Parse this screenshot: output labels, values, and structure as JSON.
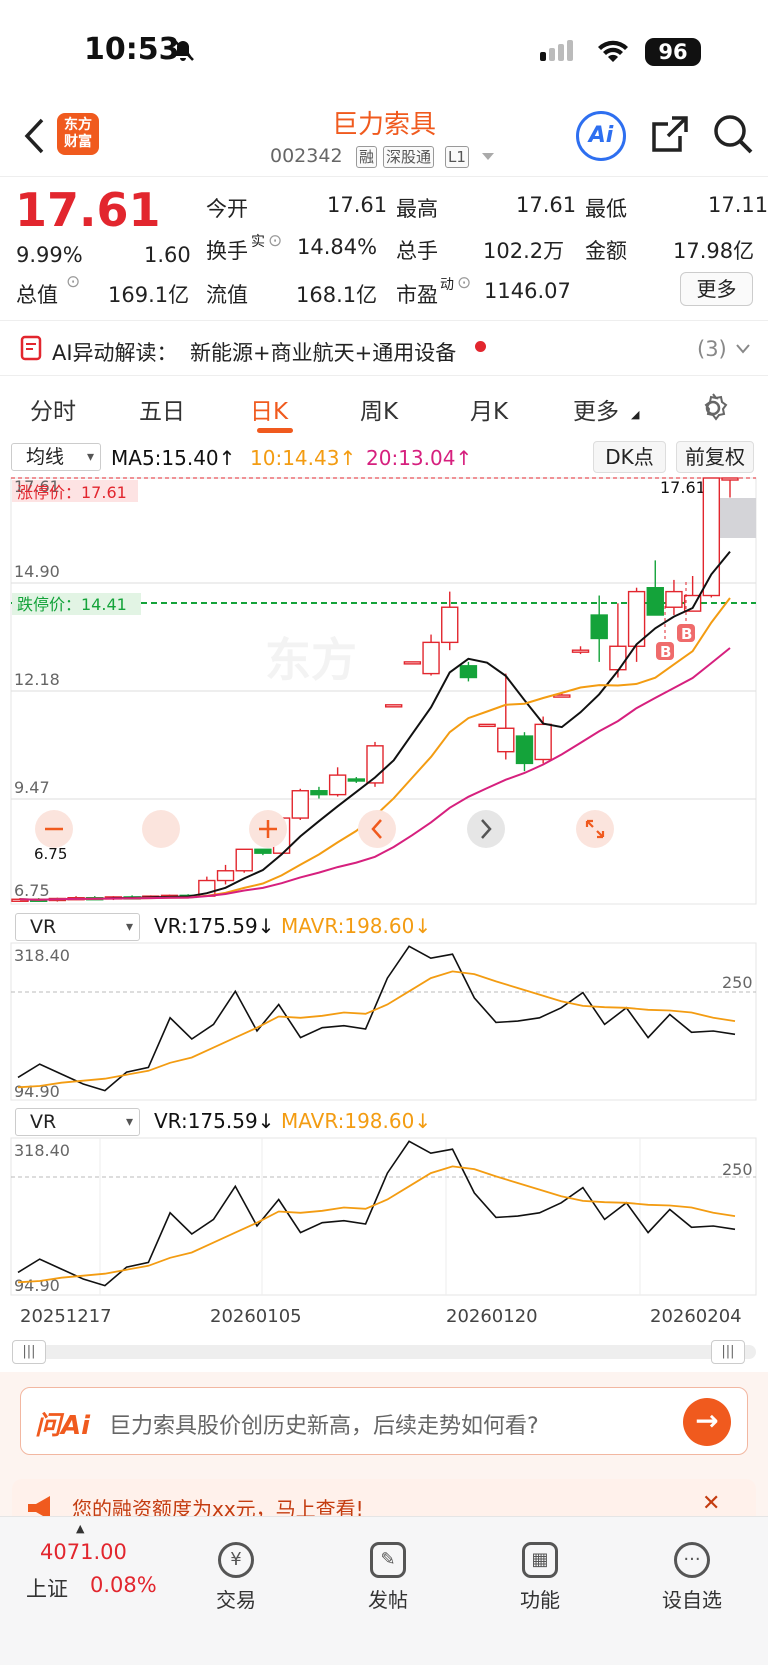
{
  "status_bar": {
    "time": "10:53",
    "battery": "96"
  },
  "header": {
    "logo_text": [
      "东方",
      "财富"
    ],
    "stock_name": "巨力索具",
    "stock_code": "002342",
    "tags": [
      "融",
      "深股通",
      "L1"
    ],
    "ai_label": "Ai"
  },
  "quote": {
    "price": "17.61",
    "change_pct": "9.99%",
    "change_amt": "1.60",
    "open_label": "今开",
    "open": "17.61",
    "high_label": "最高",
    "high": "17.61",
    "low_label": "最低",
    "low": "17.11",
    "turnover_label": "换手",
    "turnover_sup": "实",
    "turnover": "14.84%",
    "volume_label": "总手",
    "volume": "102.2万",
    "amount_label": "金额",
    "amount": "17.98亿",
    "mcap_label": "总值",
    "mcap": "169.1亿",
    "float_label": "流值",
    "float": "168.1亿",
    "pe_label": "市盈",
    "pe_sup": "动",
    "pe": "1146.07",
    "more_label": "更多"
  },
  "ai_bar": {
    "prefix": "AI异动解读：",
    "text": "新能源+商业航天+通用设备",
    "count": "(3)"
  },
  "tabs": [
    "分时",
    "五日",
    "日K",
    "周K",
    "月K",
    "更多"
  ],
  "active_tab": "日K",
  "kline": {
    "indicator_select": "均线",
    "ma5": "MA5:15.40↑",
    "ma10": "10:14.43↑",
    "ma20": "20:13.04↑",
    "dk_label": "DK点",
    "adjust_label": "前复权",
    "limit_up_label": "涨停价：17.61",
    "limit_down_label": "跌停价：14.41",
    "price_marker": "17.61→",
    "y_labels": [
      "17.61",
      "14.90",
      "12.18",
      "9.47",
      "6.75"
    ],
    "low_marker": "6.75",
    "buy_markers": [
      "B",
      "B"
    ]
  },
  "vr_panel_1": {
    "select": "VR",
    "vr": "VR:175.59↓",
    "mavr": "MAVR:198.60↓",
    "top": "318.40",
    "bottom": "94.90",
    "ref": "250"
  },
  "vr_panel_2": {
    "select": "VR",
    "vr": "VR:175.59↓",
    "mavr": "MAVR:198.60↓",
    "top": "318.40",
    "bottom": "94.90",
    "ref": "250"
  },
  "x_dates": [
    "20251217",
    "20260105",
    "20260120",
    "20260204"
  ],
  "chart_data": {
    "type": "candlestick",
    "y_axis_ticks": [
      6.75,
      9.47,
      12.18,
      14.9,
      17.61
    ],
    "dates_shown": [
      "20251217",
      "20260105",
      "20260120",
      "20260204"
    ],
    "candles": [
      {
        "o": 6.8,
        "h": 6.85,
        "l": 6.75,
        "c": 6.82
      },
      {
        "o": 6.82,
        "h": 6.85,
        "l": 6.78,
        "c": 6.8
      },
      {
        "o": 6.8,
        "h": 6.86,
        "l": 6.76,
        "c": 6.84
      },
      {
        "o": 6.84,
        "h": 6.9,
        "l": 6.8,
        "c": 6.86
      },
      {
        "o": 6.86,
        "h": 6.9,
        "l": 6.82,
        "c": 6.84
      },
      {
        "o": 6.84,
        "h": 6.9,
        "l": 6.8,
        "c": 6.88
      },
      {
        "o": 6.88,
        "h": 6.92,
        "l": 6.84,
        "c": 6.86
      },
      {
        "o": 6.86,
        "h": 6.92,
        "l": 6.84,
        "c": 6.9
      },
      {
        "o": 6.9,
        "h": 6.94,
        "l": 6.86,
        "c": 6.92
      },
      {
        "o": 6.92,
        "h": 6.95,
        "l": 6.88,
        "c": 6.9
      },
      {
        "o": 6.9,
        "h": 7.4,
        "l": 6.88,
        "c": 7.3
      },
      {
        "o": 7.3,
        "h": 7.7,
        "l": 7.2,
        "c": 7.55
      },
      {
        "o": 7.55,
        "h": 8.1,
        "l": 7.5,
        "c": 8.1
      },
      {
        "o": 8.1,
        "h": 8.1,
        "l": 7.95,
        "c": 8.0
      },
      {
        "o": 8.0,
        "h": 8.9,
        "l": 7.95,
        "c": 8.9
      },
      {
        "o": 8.9,
        "h": 9.65,
        "l": 8.85,
        "c": 9.6
      },
      {
        "o": 9.6,
        "h": 9.7,
        "l": 9.4,
        "c": 9.5
      },
      {
        "o": 9.5,
        "h": 10.2,
        "l": 9.45,
        "c": 10.0
      },
      {
        "o": 9.9,
        "h": 9.95,
        "l": 9.8,
        "c": 9.85
      },
      {
        "o": 9.8,
        "h": 10.85,
        "l": 9.7,
        "c": 10.75
      },
      {
        "o": 11.8,
        "h": 11.8,
        "l": 11.8,
        "c": 11.8
      },
      {
        "o": 12.9,
        "h": 12.9,
        "l": 12.9,
        "c": 12.9
      },
      {
        "o": 12.6,
        "h": 13.6,
        "l": 12.55,
        "c": 13.4
      },
      {
        "o": 13.4,
        "h": 14.7,
        "l": 13.2,
        "c": 14.3
      },
      {
        "o": 12.8,
        "h": 12.9,
        "l": 12.4,
        "c": 12.5
      },
      {
        "o": 11.3,
        "h": 11.3,
        "l": 11.3,
        "c": 11.3
      },
      {
        "o": 10.6,
        "h": 12.6,
        "l": 10.4,
        "c": 11.2
      },
      {
        "o": 11.0,
        "h": 11.1,
        "l": 10.1,
        "c": 10.3
      },
      {
        "o": 10.4,
        "h": 11.5,
        "l": 10.3,
        "c": 11.3
      },
      {
        "o": 12.0,
        "h": 12.1,
        "l": 12.0,
        "c": 12.05
      },
      {
        "o": 13.2,
        "h": 13.3,
        "l": 13.1,
        "c": 13.2
      },
      {
        "o": 14.1,
        "h": 14.6,
        "l": 12.9,
        "c": 13.5
      },
      {
        "o": 12.7,
        "h": 14.4,
        "l": 12.5,
        "c": 13.3
      },
      {
        "o": 13.3,
        "h": 14.8,
        "l": 12.9,
        "c": 14.7
      },
      {
        "o": 14.8,
        "h": 15.5,
        "l": 14.3,
        "c": 14.1
      },
      {
        "o": 14.3,
        "h": 15.0,
        "l": 14.1,
        "c": 14.7
      },
      {
        "o": 14.2,
        "h": 15.1,
        "l": 14.2,
        "c": 14.6
      },
      {
        "o": 14.6,
        "h": 17.61,
        "l": 14.55,
        "c": 17.61
      },
      {
        "o": 17.61,
        "h": 17.61,
        "l": 17.11,
        "c": 17.61
      }
    ],
    "vr_values": [
      120,
      140,
      125,
      110,
      100,
      128,
      135,
      210,
      178,
      200,
      250,
      190,
      230,
      180,
      195,
      198,
      193,
      270,
      318,
      300,
      306,
      240,
      203,
      205,
      210,
      225,
      248,
      200,
      225,
      180,
      215,
      188,
      190,
      185
    ],
    "mavr_values": [
      105,
      107,
      112,
      115,
      118,
      124,
      130,
      142,
      150,
      165,
      180,
      195,
      212,
      210,
      213,
      218,
      216,
      230,
      250,
      270,
      280,
      276,
      265,
      255,
      245,
      235,
      228,
      226,
      225,
      222,
      221,
      218,
      210,
      205
    ]
  },
  "scroll": {
    "left": "|||",
    "right": "|||"
  },
  "ask_ai": {
    "logo": "问Ai",
    "prompt": "巨力索具股价创历史新高，后续走势如何看?"
  },
  "notice": {
    "text": "您的融资额度为xx元，马上查看!"
  },
  "bottom_bar": {
    "index_value": "4071.00",
    "index_name": "上证",
    "index_change": "0.08%",
    "items": [
      "交易",
      "发帖",
      "功能",
      "设自选"
    ]
  },
  "colors": {
    "accent": "#f05a1e",
    "up": "#e2262e",
    "down": "#14a33a",
    "ma5": "#111111",
    "ma10": "#f39c12",
    "ma20": "#d6207e"
  }
}
